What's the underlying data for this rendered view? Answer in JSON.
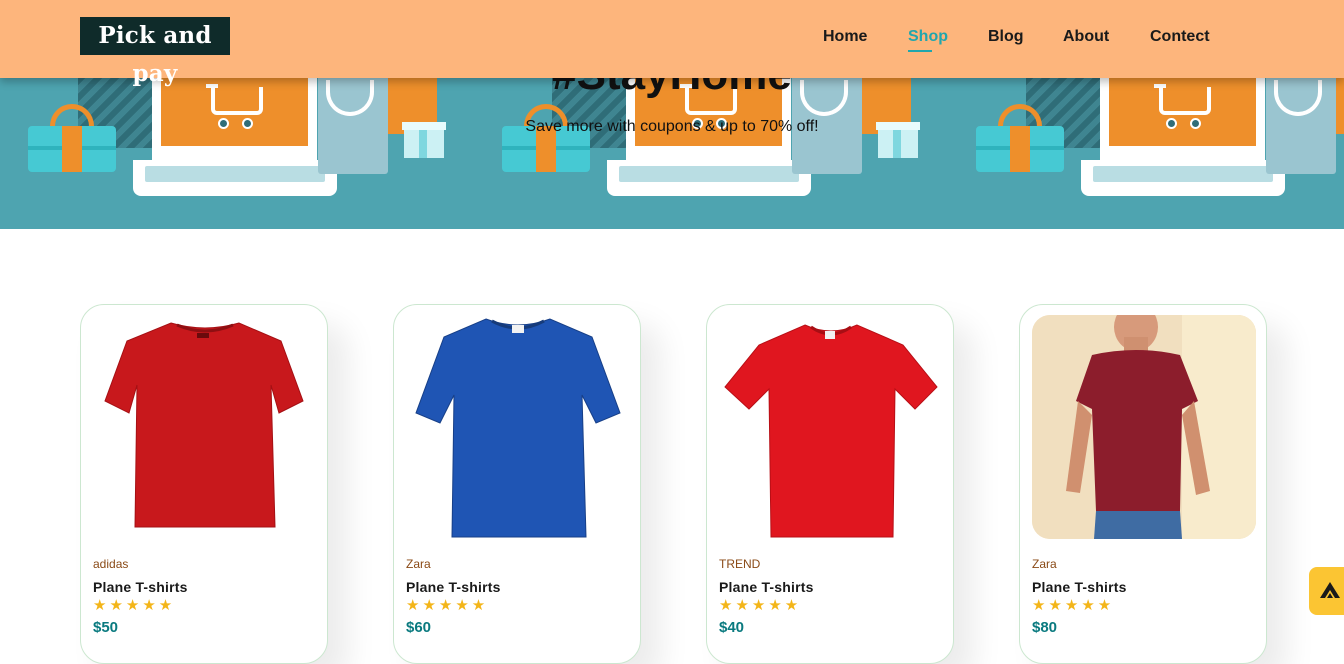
{
  "header": {
    "logo": "Pick and pay",
    "nav": [
      {
        "label": "Home",
        "active": false
      },
      {
        "label": "Shop",
        "active": true
      },
      {
        "label": "Blog",
        "active": false
      },
      {
        "label": "About",
        "active": false
      },
      {
        "label": "Contect",
        "active": false
      }
    ],
    "accent_color": "#21a6ad",
    "background_color": "#fdb57c"
  },
  "hero": {
    "title": "#StayHome",
    "subtitle": "Save more with coupons & up to 70% off!"
  },
  "products": [
    {
      "brand": "adidas",
      "name": "Plane T-shirts",
      "stars": "★★★★★",
      "price": "$50",
      "shirt_color": "#c8181c",
      "image": "red-tshirt"
    },
    {
      "brand": "Zara",
      "name": "Plane T-shirts",
      "stars": "★★★★★",
      "price": "$60",
      "shirt_color": "#1f55b4",
      "image": "blue-tshirt"
    },
    {
      "brand": "TREND",
      "name": "Plane T-shirts",
      "stars": "★★★★★",
      "price": "$40",
      "shirt_color": "#e0161f",
      "image": "red-tshirt"
    },
    {
      "brand": "Zara",
      "name": "Plane T-shirts",
      "stars": "★★★★★",
      "price": "$80",
      "shirt_color": "#8c1d2c",
      "image": "man-wearing-maroon-tshirt"
    }
  ],
  "floating_button": {
    "icon": "triangle-logo-icon",
    "color": "#fbc533"
  }
}
